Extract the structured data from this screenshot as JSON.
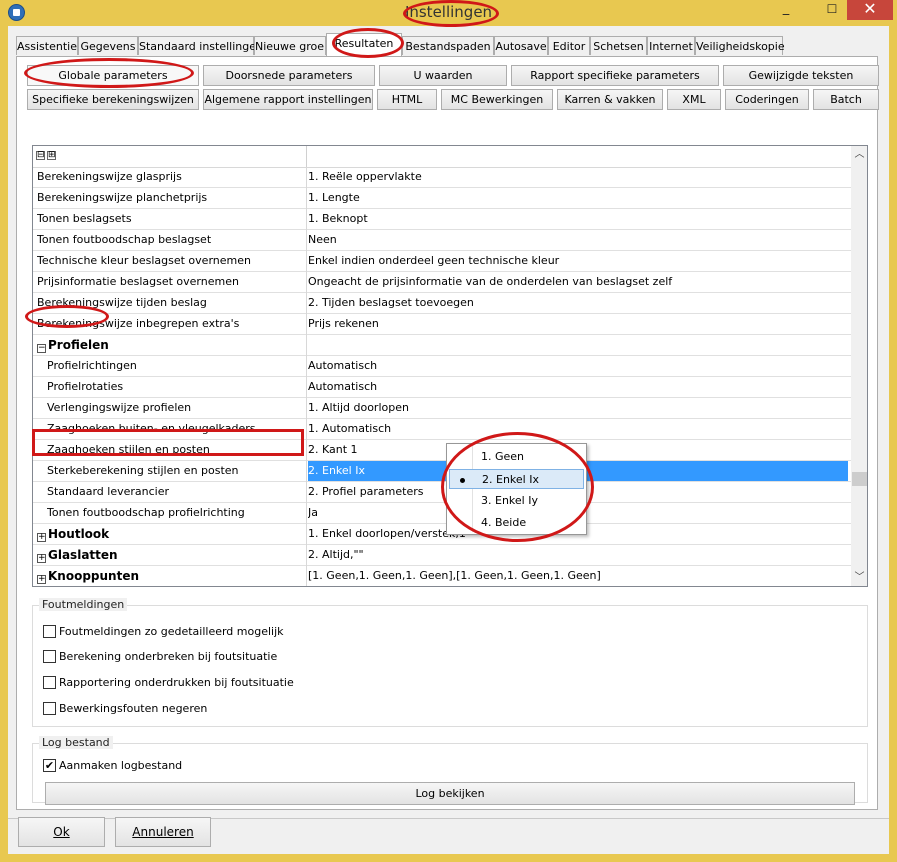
{
  "window": {
    "title": "Instellingen",
    "minimize": "_",
    "maximize": "☐",
    "close": "✕"
  },
  "tabs": [
    "Assistentie",
    "Gegevens",
    "Standaard instellingen",
    "Nieuwe groep",
    "Resultaten",
    "Bestandspaden",
    "Autosave",
    "Editor",
    "Schetsen",
    "Internet",
    "Veiligheidskopie"
  ],
  "active_tab": "Resultaten",
  "subtabs_row1": [
    "Globale parameters",
    "Doorsnede parameters",
    "U waarden",
    "Rapport specifieke parameters",
    "Gewijzigde teksten"
  ],
  "subtabs_row2": [
    "Specifieke berekeningswijzen",
    "Algemene rapport instellingen",
    "HTML",
    "MC Bewerkingen",
    "Karren & vakken",
    "XML",
    "Coderingen",
    "Batch"
  ],
  "grid": {
    "collapse_all": "⊟",
    "expand_all": "⊞",
    "rows": [
      {
        "label": "Berekeningswijze glasprijs",
        "value": "1. Reële oppervlakte"
      },
      {
        "label": "Berekeningswijze planchetprijs",
        "value": "1. Lengte"
      },
      {
        "label": "Tonen beslagsets",
        "value": "1. Beknopt"
      },
      {
        "label": "Tonen foutboodschap beslagset",
        "value": "Neen"
      },
      {
        "label": "Technische kleur beslagset overnemen",
        "value": "Enkel indien onderdeel geen technische kleur"
      },
      {
        "label": "Prijsinformatie beslagset overnemen",
        "value": "Ongeacht de prijsinformatie van de onderdelen van beslagset zelf"
      },
      {
        "label": "Berekeningswijze tijden beslag",
        "value": "2.  Tijden beslagset toevoegen"
      },
      {
        "label": "Berekeningswijze inbegrepen extra's",
        "value": "Prijs rekenen"
      },
      {
        "label": "Profielen",
        "value": "",
        "category": true,
        "expander": "−"
      },
      {
        "label": "Profielrichtingen",
        "value": "Automatisch"
      },
      {
        "label": "Profielrotaties",
        "value": "Automatisch"
      },
      {
        "label": "Verlengingswijze profielen",
        "value": "1. Altijd doorlopen"
      },
      {
        "label": "Zaaghoeken buiten- en vleugelkaders",
        "value": "1. Automatisch"
      },
      {
        "label": "Zaaghoeken stijlen en posten",
        "value": "2. Kant 1"
      },
      {
        "label": "Sterkeberekening stijlen en posten",
        "value": "2. Enkel Ix",
        "selected": true
      },
      {
        "label": "Standaard leverancier",
        "value": "2. Profiel parameters"
      },
      {
        "label": "Tonen foutboodschap profielrichting",
        "value": "Ja"
      },
      {
        "label": "Houtlook",
        "value": "1. Enkel doorlopen/verstek,1",
        "category": true,
        "expander": "+"
      },
      {
        "label": "Glaslatten",
        "value": "2. Altijd,\"\"",
        "category": true,
        "expander": "+"
      },
      {
        "label": "Knooppunten",
        "value": "[1. Geen,1. Geen,1. Geen],[1. Geen,1. Geen,1. Geen]",
        "category": true,
        "expander": "+"
      }
    ]
  },
  "dropdown": {
    "options": [
      "1. Geen",
      "2. Enkel Ix",
      "3. Enkel Iy",
      "4. Beide"
    ],
    "selected_index": 1
  },
  "foutmeldingen": {
    "title": "Foutmeldingen",
    "items": [
      {
        "label": "Foutmeldingen zo gedetailleerd mogelijk",
        "checked": false
      },
      {
        "label": "Berekening onderbreken bij foutsituatie",
        "checked": false
      },
      {
        "label": "Rapportering onderdrukken bij foutsituatie",
        "checked": false
      },
      {
        "label": "Bewerkingsfouten negeren",
        "checked": false
      }
    ]
  },
  "log": {
    "title": "Log bestand",
    "create_label": "Aanmaken logbestand",
    "create_checked": true,
    "view_button": "Log bekijken"
  },
  "buttons": {
    "ok": "Ok",
    "cancel": "Annuleren"
  },
  "colors": {
    "titlebar": "#e8c850",
    "selection": "#3399ff",
    "annotation": "#d01818"
  }
}
